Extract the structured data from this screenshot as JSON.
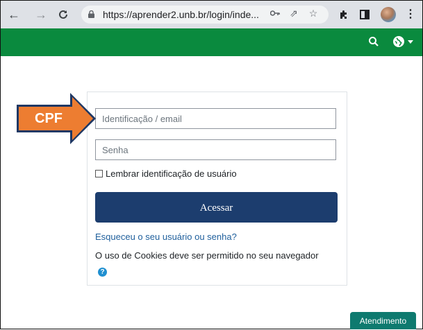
{
  "browser": {
    "url": "https://aprender2.unb.br/login/inde...",
    "icons": [
      "back-arrow-icon",
      "forward-arrow-icon",
      "reload-icon",
      "lock-icon",
      "key-icon",
      "share-icon",
      "star-icon",
      "extensions-icon",
      "sidepanel-icon",
      "avatar",
      "kebab-menu-icon"
    ]
  },
  "annotation": {
    "label": "CPF",
    "color": "#ed7d31"
  },
  "login": {
    "username_placeholder": "Identificação / email",
    "password_placeholder": "Senha",
    "remember_label": "Lembrar identificação de usuário",
    "submit_label": "Acessar",
    "forgot_link": "Esqueceu o seu usuário ou senha?",
    "cookies_notice": "O uso de Cookies deve ser permitido no seu navegador",
    "help_glyph": "?"
  },
  "support": {
    "label": "Atendimento"
  },
  "colors": {
    "navbar": "#0a8a3e",
    "primary_button": "#1c3d6e",
    "link": "#1f5f9c",
    "support_button": "#0e7a6f"
  }
}
